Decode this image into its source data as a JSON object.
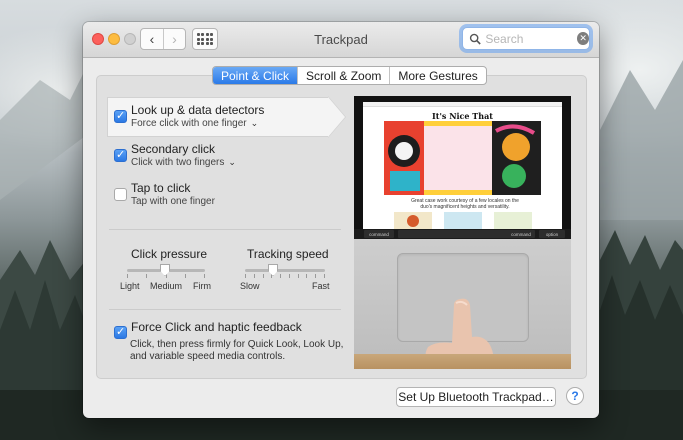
{
  "window": {
    "title": "Trackpad"
  },
  "search": {
    "placeholder": "Search",
    "value": ""
  },
  "tabs": [
    {
      "label": "Point & Click",
      "active": true
    },
    {
      "label": "Scroll & Zoom",
      "active": false
    },
    {
      "label": "More Gestures",
      "active": false
    }
  ],
  "options": [
    {
      "title": "Look up & data detectors",
      "subtitle": "Force click with one finger",
      "checked": true,
      "has_menu": true
    },
    {
      "title": "Secondary click",
      "subtitle": "Click with two fingers",
      "checked": true,
      "has_menu": true
    },
    {
      "title": "Tap to click",
      "subtitle": "Tap with one finger",
      "checked": false,
      "has_menu": false
    }
  ],
  "sliders": {
    "click_pressure": {
      "label": "Click pressure",
      "ticks": [
        "Light",
        "Medium",
        "Firm"
      ],
      "value": "Medium"
    },
    "tracking_speed": {
      "label": "Tracking speed",
      "min_label": "Slow",
      "max_label": "Fast",
      "value_fraction": 0.33
    }
  },
  "force_click": {
    "title": "Force Click and haptic feedback",
    "checked": true,
    "description": "Click, then press firmly for Quick Look, Look Up, and variable speed media controls."
  },
  "preview": {
    "site_title": "It's Nice That",
    "caption": "Great case work courtesy of a few locales on the duo's magnificent heights and versatility.",
    "keys": [
      "command",
      "command",
      "option"
    ]
  },
  "buttons": {
    "setup_bluetooth": "Set Up Bluetooth Trackpad…",
    "help": "?"
  },
  "colors": {
    "accent": "#2b7ae8",
    "close": "#fc605c",
    "minimize": "#fdbc40"
  }
}
